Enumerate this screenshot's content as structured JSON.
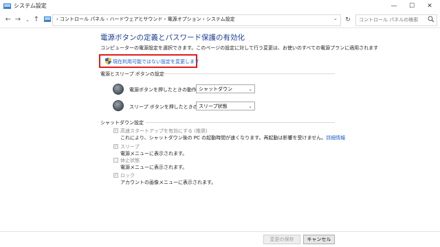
{
  "window": {
    "title": "システム設定",
    "controls": {
      "minimize": "—",
      "maximize": "☐",
      "close": "✕"
    }
  },
  "nav": {
    "back": "←",
    "forward": "→",
    "dropdown": "⌄",
    "up": "↑",
    "breadcrumb": "›  コントロール パネル  ›  ハードウェアとサウンド  ›  電源オプション  ›  システム設定",
    "address_dropdown": "⌄",
    "refresh": "↻",
    "search_placeholder": "コントロール パネルの検索"
  },
  "main": {
    "heading": "電源ボタンの定義とパスワード保護の有効化",
    "description": "コンピューターの電源設定を選択できます。このページの設定に対して行う変更は、お使いのすべての電源プランに適用されます",
    "change_link": "現在利用可能ではない設定を変更します"
  },
  "buttons_section": {
    "label": "電源とスリープ ボタンの設定",
    "rows": [
      {
        "label": "電源ボタンを押したときの動作:",
        "value": "シャットダウン"
      },
      {
        "label": "スリープ ボタンを押したときの動作:",
        "value": "スリープ状態"
      }
    ]
  },
  "shutdown_section": {
    "label": "シャットダウン設定",
    "options": [
      {
        "title": "高速スタートアップを有効にする (推奨)",
        "checked": true,
        "desc": "これにより、シャットダウン後の PC の起動時間が速くなります。再起動は影響を受けません。",
        "link": "詳細情報"
      },
      {
        "title": "スリープ",
        "checked": true,
        "desc": "電源メニューに表示されます。"
      },
      {
        "title": "休止状態",
        "checked": false,
        "desc": "電源メニューに表示されます。"
      },
      {
        "title": "ロック",
        "checked": true,
        "desc": "アカウントの画像メニューに表示されます。"
      }
    ]
  },
  "footer": {
    "save_label": "変更の保存",
    "cancel_label": "キャンセル"
  },
  "colors": {
    "heading": "#1a3e8f",
    "link": "#1a5fc9",
    "highlight_box": "#e01919"
  }
}
